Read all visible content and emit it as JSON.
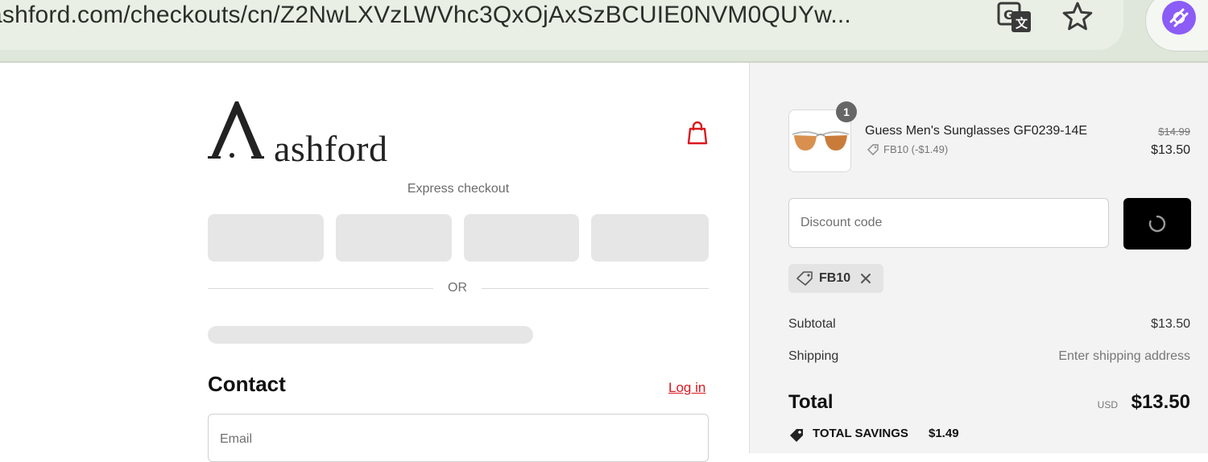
{
  "browser": {
    "url": "ashford.com/checkouts/cn/Z2NwLXVzLWVhc3QxOjAxSzBCUIE0NVM0QUYw...",
    "icons": [
      "translate-icon",
      "star-icon",
      "profile-icon"
    ]
  },
  "checkout": {
    "brand_logo": "ashford",
    "express_label": "Express checkout",
    "divider_label": "OR",
    "contact_heading": "Contact",
    "login_label": "Log in",
    "email_placeholder": "Email"
  },
  "summary": {
    "item": {
      "quantity": "1",
      "name": "Guess Men's Sunglasses GF0239-14E",
      "discount_note": "FB10 (-$1.49)",
      "price_original": "$14.99",
      "price_final": "$13.50"
    },
    "discount_placeholder": "Discount code",
    "applied_code": "FB10",
    "subtotal_label": "Subtotal",
    "subtotal_value": "$13.50",
    "shipping_label": "Shipping",
    "shipping_value": "Enter shipping address",
    "total_label": "Total",
    "total_currency": "USD",
    "total_value": "$13.50",
    "savings_label": "TOTAL SAVINGS",
    "savings_value": "$1.49"
  },
  "colors": {
    "accent_red": "#d9191f",
    "apply_button": "#000000",
    "profile_purple": "#8b5cf6"
  }
}
